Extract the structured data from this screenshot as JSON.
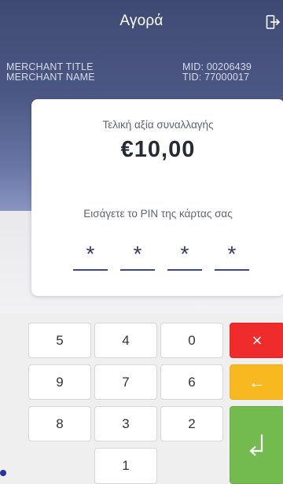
{
  "header": {
    "title": "Αγορά",
    "exit_icon": "exit-icon",
    "background": "#4a5582"
  },
  "merchant": {
    "title": "MERCHANT TITLE",
    "name": "MERCHANT NAME",
    "mid": "MID: 00206439",
    "tid": "TID: 77000017"
  },
  "transaction": {
    "amount_label": "Τελική αξία συναλλαγής",
    "amount": "€10,00",
    "pin_prompt": "Εισάγετε το PIN της κάρτας σας",
    "pin_digits": [
      "*",
      "*",
      "*",
      "*"
    ],
    "pin_line_color": "#3b4a7a"
  },
  "keypad": {
    "keys": [
      "5",
      "4",
      "0",
      "9",
      "7",
      "6",
      "8",
      "3",
      "2",
      "1"
    ],
    "cancel_label": "×",
    "back_label": "←",
    "cancel_color": "#ef2b2b",
    "back_color": "#f8b81f",
    "enter_color": "#73ba4f"
  }
}
